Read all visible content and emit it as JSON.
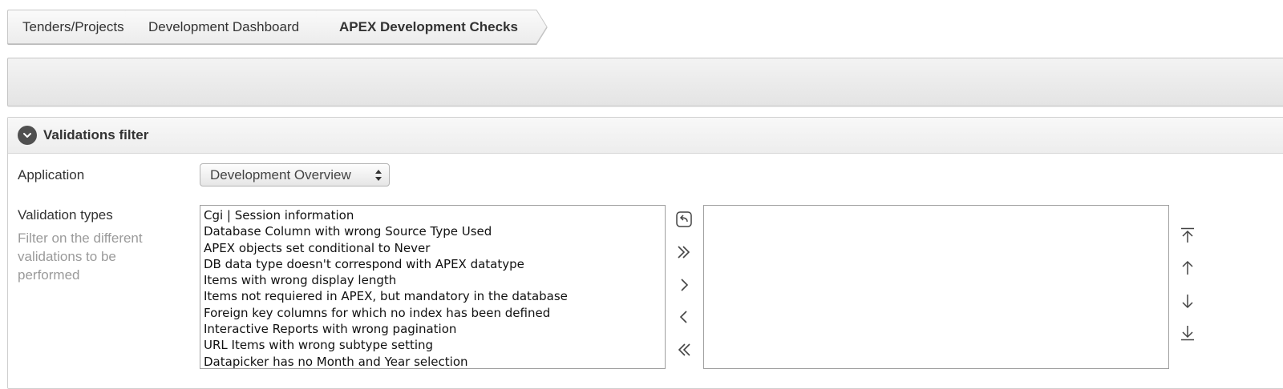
{
  "breadcrumb": {
    "items": [
      {
        "label": "Tenders/Projects"
      },
      {
        "label": "Development Dashboard"
      },
      {
        "label": "APEX Development Checks"
      }
    ]
  },
  "filter": {
    "title": "Validations filter",
    "application": {
      "label": "Application",
      "selected": "Development Overview"
    },
    "validation_types": {
      "label": "Validation types",
      "help": "Filter on the different validations to be performed",
      "available": [
        "Cgi | Session information",
        "Database Column with wrong Source Type Used",
        "APEX objects set conditional to Never",
        "DB data type doesn't correspond with APEX datatype",
        "Items with wrong display length",
        "Items not requiered in APEX, but mandatory in the database",
        "Foreign key columns for which no index has been defined",
        "Interactive Reports with wrong pagination",
        "URL Items with wrong subtype setting",
        "Datapicker has no Month and Year selection"
      ],
      "selected": []
    }
  },
  "icons": {
    "collapse": "chevron-down-circle-icon",
    "reset": "undo-icon",
    "move_all": "double-chevron-right-icon",
    "move": "chevron-right-icon",
    "remove": "chevron-left-icon",
    "remove_all": "double-chevron-left-icon",
    "top": "arrow-to-top-icon",
    "up": "arrow-up-icon",
    "down": "arrow-down-icon",
    "bottom": "arrow-to-bottom-icon"
  },
  "colors": {
    "help_text": "#9a9a9a",
    "toggle": "#505050"
  }
}
